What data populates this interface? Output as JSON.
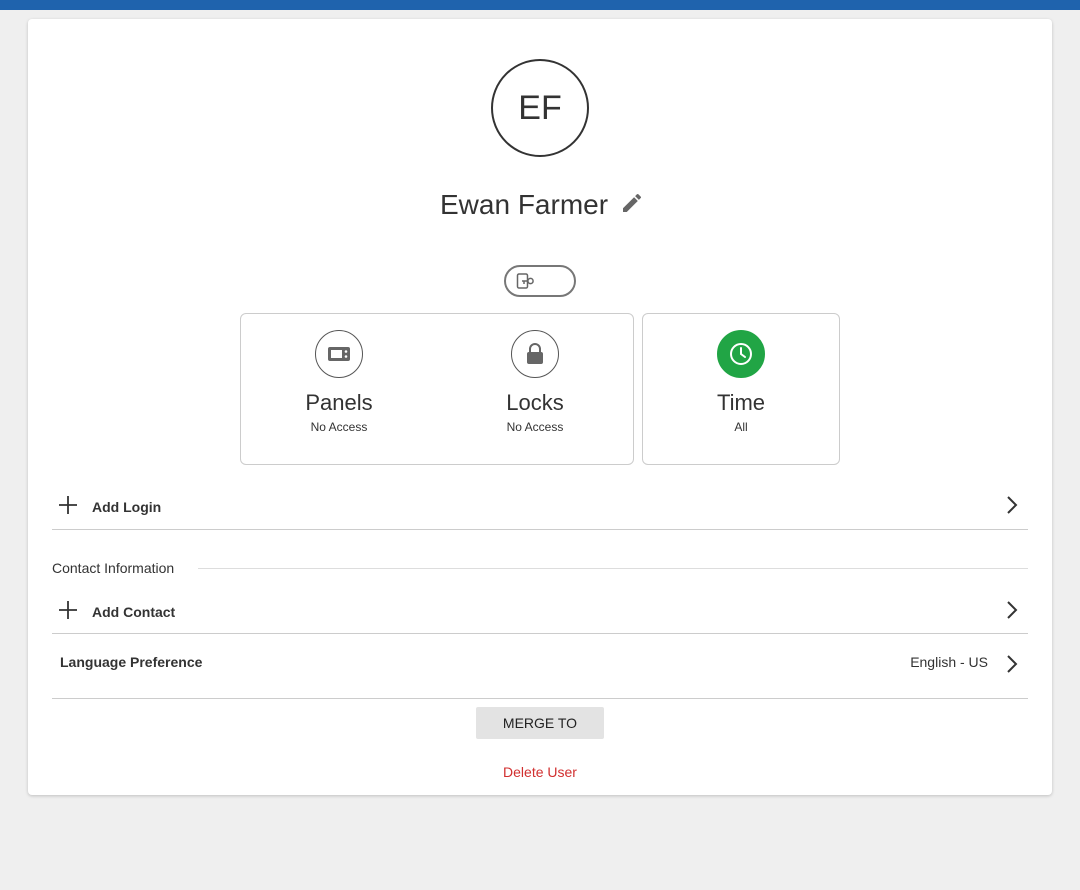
{
  "user": {
    "initials": "EF",
    "full_name": "Ewan Farmer"
  },
  "icons": {
    "edit": "pencil-icon",
    "credential": "credential-key-icon",
    "panels": "panel-icon",
    "locks": "lock-icon",
    "time": "clock-icon",
    "add": "plus-icon",
    "navigate": "chevron-right-icon"
  },
  "access": {
    "panels": {
      "title": "Panels",
      "status": "No Access"
    },
    "locks": {
      "title": "Locks",
      "status": "No Access"
    },
    "time": {
      "title": "Time",
      "status": "All"
    }
  },
  "login": {
    "add_label": "Add Login"
  },
  "contact": {
    "section_title": "Contact Information",
    "add_label": "Add Contact"
  },
  "language": {
    "label": "Language Preference",
    "value": "English - US"
  },
  "actions": {
    "merge_label": "MERGE TO",
    "delete_label": "Delete User"
  },
  "colors": {
    "top_bar": "#1f63ad",
    "time_active": "#21a545",
    "danger": "#d12f2f",
    "background": "#efefef"
  }
}
